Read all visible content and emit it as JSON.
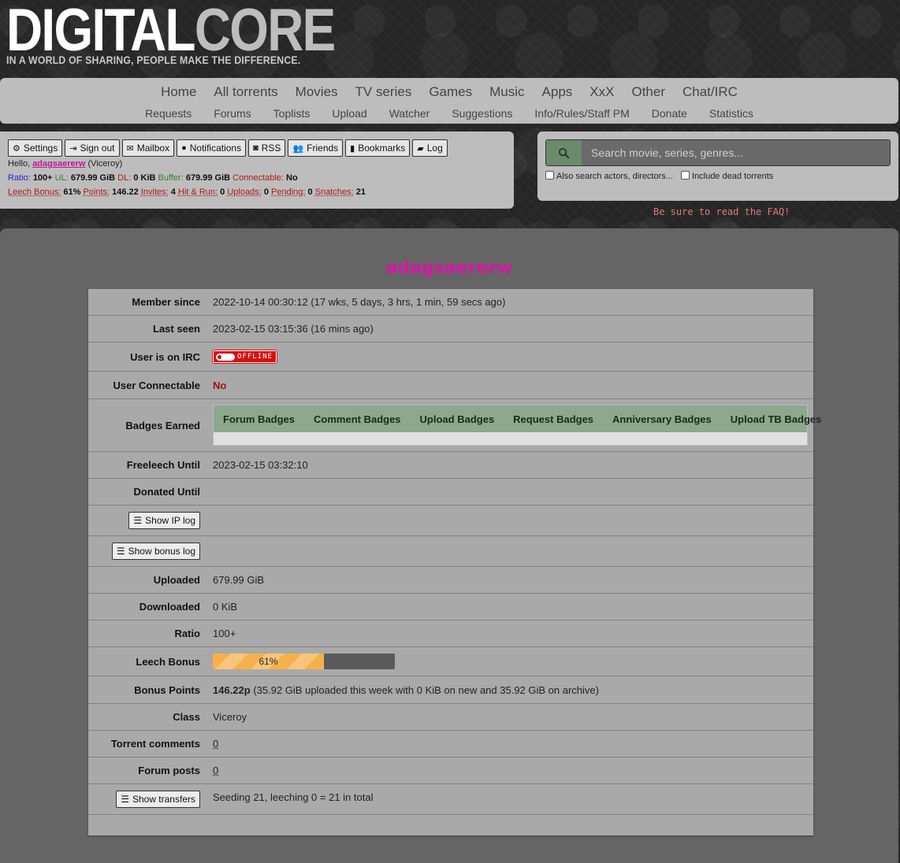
{
  "header": {
    "logo_word1": "DIGITAL",
    "logo_word2": "CORE",
    "tagline": "IN A WORLD OF SHARING, PEOPLE MAKE THE DIFFERENCE."
  },
  "nav": {
    "primary": [
      "Home",
      "All torrents",
      "Movies",
      "TV series",
      "Games",
      "Music",
      "Apps",
      "XxX",
      "Other",
      "Chat/IRC"
    ],
    "secondary": [
      "Requests",
      "Forums",
      "Toplists",
      "Upload",
      "Watcher",
      "Suggestions",
      "Info/Rules/Staff PM",
      "Donate",
      "Statistics"
    ]
  },
  "userbar": {
    "buttons": [
      {
        "label": "Settings",
        "icon": "gear-icon"
      },
      {
        "label": "Sign out",
        "icon": "sign-out-icon"
      },
      {
        "label": "Mailbox",
        "icon": "envelope-icon"
      },
      {
        "label": "Notifications",
        "icon": "bell-icon"
      },
      {
        "label": "RSS",
        "icon": "rss-icon"
      },
      {
        "label": "Friends",
        "icon": "users-icon"
      },
      {
        "label": "Bookmarks",
        "icon": "bookmark-icon"
      },
      {
        "label": "Log",
        "icon": "book-icon"
      }
    ],
    "hello": "Hello,",
    "username": "adagsaererw",
    "class_paren": "(Viceroy)",
    "ratio_label": "Ratio:",
    "ratio_value": "100+",
    "ul_label": "UL:",
    "ul_value": "679.99 GiB",
    "dl_label": "DL:",
    "dl_value": "0 KiB",
    "buffer_label": "Buffer:",
    "buffer_value": "679.99 GiB",
    "connectable_label": "Connectable:",
    "connectable_value": "No",
    "leech_label": "Leech Bonus:",
    "leech_value": "61%",
    "points_label": "Points:",
    "points_value": "146.22",
    "invites_label": "Invites:",
    "invites_value": "4",
    "hitrun_label": "Hit & Run:",
    "hitrun_value": "0",
    "uploads_label": "Uploads:",
    "uploads_value": "0",
    "pending_label": "Pending:",
    "pending_value": "0",
    "snatches_label": "Snatches:",
    "snatches_value": "21"
  },
  "search": {
    "placeholder": "Search movie, series, genres...",
    "opt1": "Also search actors, directors...",
    "opt2": "Include dead torrents",
    "faq": "Be sure to read the FAQ!"
  },
  "profile": {
    "title": "adagsaererw",
    "member_since_label": "Member since",
    "member_since_value": "2022-10-14 00:30:12 (17 wks, 5 days, 3 hrs, 1 min, 59 secs ago)",
    "last_seen_label": "Last seen",
    "last_seen_value": "2023-02-15 03:15:36 (16 mins ago)",
    "irc_label": "User is on IRC",
    "irc_status": "OFFLINE",
    "connectable_label": "User Connectable",
    "connectable_value": "No",
    "badges_label": "Badges Earned",
    "badge_tabs": [
      "Forum Badges",
      "Comment Badges",
      "Upload Badges",
      "Request Badges",
      "Anniversary Badges",
      "Upload TB Badges"
    ],
    "freeleech_label": "Freeleech Until",
    "freeleech_value": "2023-02-15 03:32:10",
    "donated_label": "Donated Until",
    "show_ip_log": "Show IP log",
    "show_bonus_log": "Show bonus log",
    "uploaded_label": "Uploaded",
    "uploaded_value": "679.99 GiB",
    "downloaded_label": "Downloaded",
    "downloaded_value": "0 KiB",
    "ratio_label": "Ratio",
    "ratio_value": "100+",
    "leech_label": "Leech Bonus",
    "leech_text": "61%",
    "leech_fraction": 0.61,
    "bonus_label": "Bonus Points",
    "bonus_value": "146.22p",
    "bonus_detail": "(35.92 GiB uploaded this week with 0 KiB on new and 35.92 GiB on archive)",
    "class_label": "Class",
    "class_value": "Viceroy",
    "torrent_comments_label": "Torrent comments",
    "torrent_comments_value": "0",
    "forum_posts_label": "Forum posts",
    "forum_posts_value": "0",
    "show_transfers": "Show transfers",
    "transfers_value": "Seeding 21, leeching 0 = 21 in total"
  }
}
